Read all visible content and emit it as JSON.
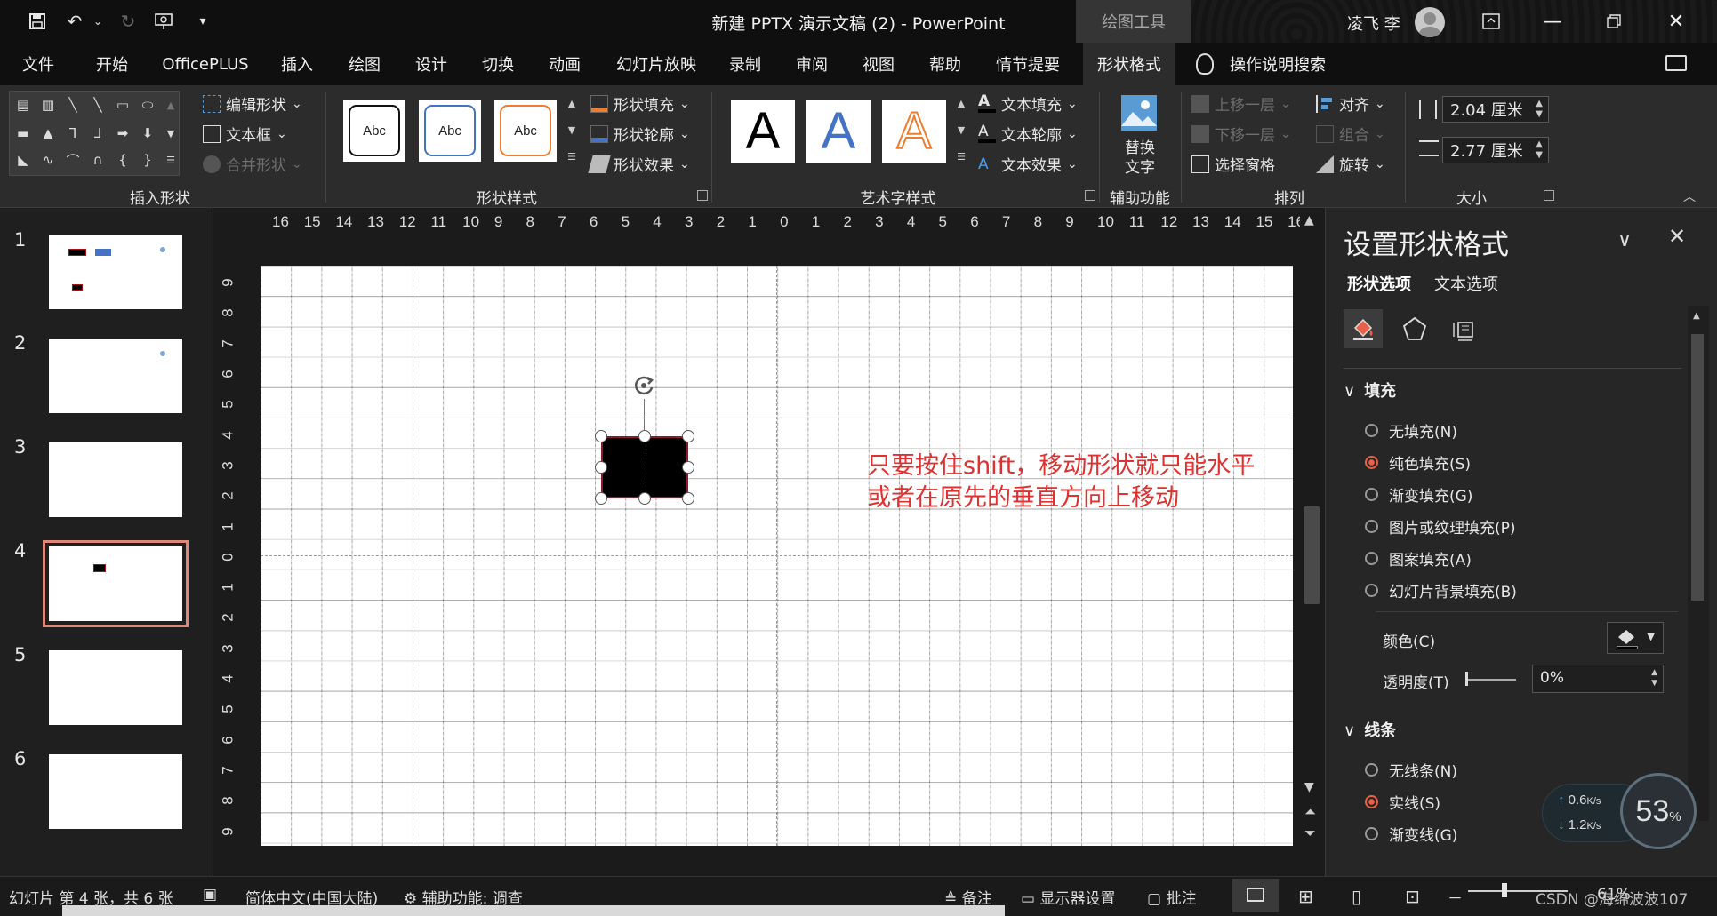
{
  "titlebar": {
    "title": "新建 PPTX 演示文稿 (2)  -  PowerPoint",
    "contextual_tab_group": "绘图工具",
    "user_name": "凌飞 李",
    "quick_access": [
      "save-icon",
      "undo-icon",
      "redo-icon",
      "presenter-icon",
      "customize-icon"
    ],
    "window_controls": [
      "ribbon-display-icon",
      "minimize-icon",
      "restore-icon",
      "close-icon"
    ]
  },
  "menu": {
    "tabs": [
      "文件",
      "开始",
      "OfficePLUS",
      "插入",
      "绘图",
      "设计",
      "切换",
      "动画",
      "幻灯片放映",
      "录制",
      "审阅",
      "视图",
      "帮助",
      "情节提要",
      "形状格式"
    ],
    "active_tab": "形状格式",
    "tell_me": "操作说明搜索"
  },
  "ribbon": {
    "insert_shapes": {
      "label": "插入形状",
      "edit_shape": "编辑形状",
      "text_box": "文本框",
      "merge_shapes": "合并形状"
    },
    "shape_styles": {
      "label": "形状样式",
      "thumb_text": "Abc",
      "fill": "形状填充",
      "outline": "形状轮廓",
      "effects": "形状效果"
    },
    "wordart_styles": {
      "label": "艺术字样式",
      "sample": "A",
      "text_fill": "文本填充",
      "text_outline": "文本轮廓",
      "text_effects": "文本效果"
    },
    "accessibility": {
      "label": "辅助功能",
      "alt_text_line1": "替换",
      "alt_text_line2": "文字"
    },
    "arrange": {
      "label": "排列",
      "bring_forward": "上移一层",
      "send_backward": "下移一层",
      "selection_pane": "选择窗格",
      "align": "对齐",
      "group": "组合",
      "rotate": "旋转"
    },
    "size": {
      "label": "大小",
      "height": "2.04 厘米",
      "width": "2.77 厘米"
    }
  },
  "rulers": {
    "horizontal": [
      "16",
      "15",
      "14",
      "13",
      "12",
      "11",
      "10",
      "9",
      "8",
      "7",
      "6",
      "5",
      "4",
      "3",
      "2",
      "1",
      "0",
      "1",
      "2",
      "3",
      "4",
      "5",
      "6",
      "7",
      "8",
      "9",
      "10",
      "11",
      "12",
      "13",
      "14",
      "15",
      "16"
    ],
    "vertical": [
      "9",
      "8",
      "7",
      "6",
      "5",
      "4",
      "3",
      "2",
      "1",
      "0",
      "1",
      "2",
      "3",
      "4",
      "5",
      "6",
      "7",
      "8",
      "9"
    ]
  },
  "slides": {
    "numbers": [
      "1",
      "2",
      "3",
      "4",
      "5",
      "6"
    ],
    "selected": 4
  },
  "canvas": {
    "annotation_line1": "只要按住shift，移动形状就只能水平",
    "annotation_line2": "或者在原先的垂直方向上移动"
  },
  "format_pane": {
    "title": "设置形状格式",
    "tab_shape": "形状选项",
    "tab_text": "文本选项",
    "icon_tabs": [
      "fill-line-icon",
      "effects-pentagon-icon",
      "size-properties-icon"
    ],
    "fill_section": "填充",
    "fill_options": [
      "无填充(N)",
      "纯色填充(S)",
      "渐变填充(G)",
      "图片或纹理填充(P)",
      "图案填充(A)",
      "幻灯片背景填充(B)"
    ],
    "fill_selected": 1,
    "color_label": "颜色(C)",
    "transparency_label": "透明度(T)",
    "transparency_value": "0%",
    "line_section": "线条",
    "line_options": [
      "无线条(N)",
      "实线(S)",
      "渐变线(G)"
    ],
    "line_selected": 1
  },
  "speed_widget": {
    "up": "0.6",
    "down": "1.2",
    "unit": "K/s",
    "percent": "53",
    "percent_sign": "%"
  },
  "status": {
    "slide_info": "幻灯片 第 4 张，共 6 张",
    "language": "简体中文(中国大陆)",
    "accessibility": "辅助功能: 调查",
    "notes": "备注",
    "display_settings": "显示器设置",
    "comments": "批注",
    "zoom_minus": "－",
    "zoom": "61%",
    "watermark": "CSDN @海绵波波107"
  },
  "colors": {
    "accent": "#e8624a",
    "annotation_red": "#e03030",
    "shape_fill": "#000000",
    "shape_outline": "#8b1a2c"
  }
}
